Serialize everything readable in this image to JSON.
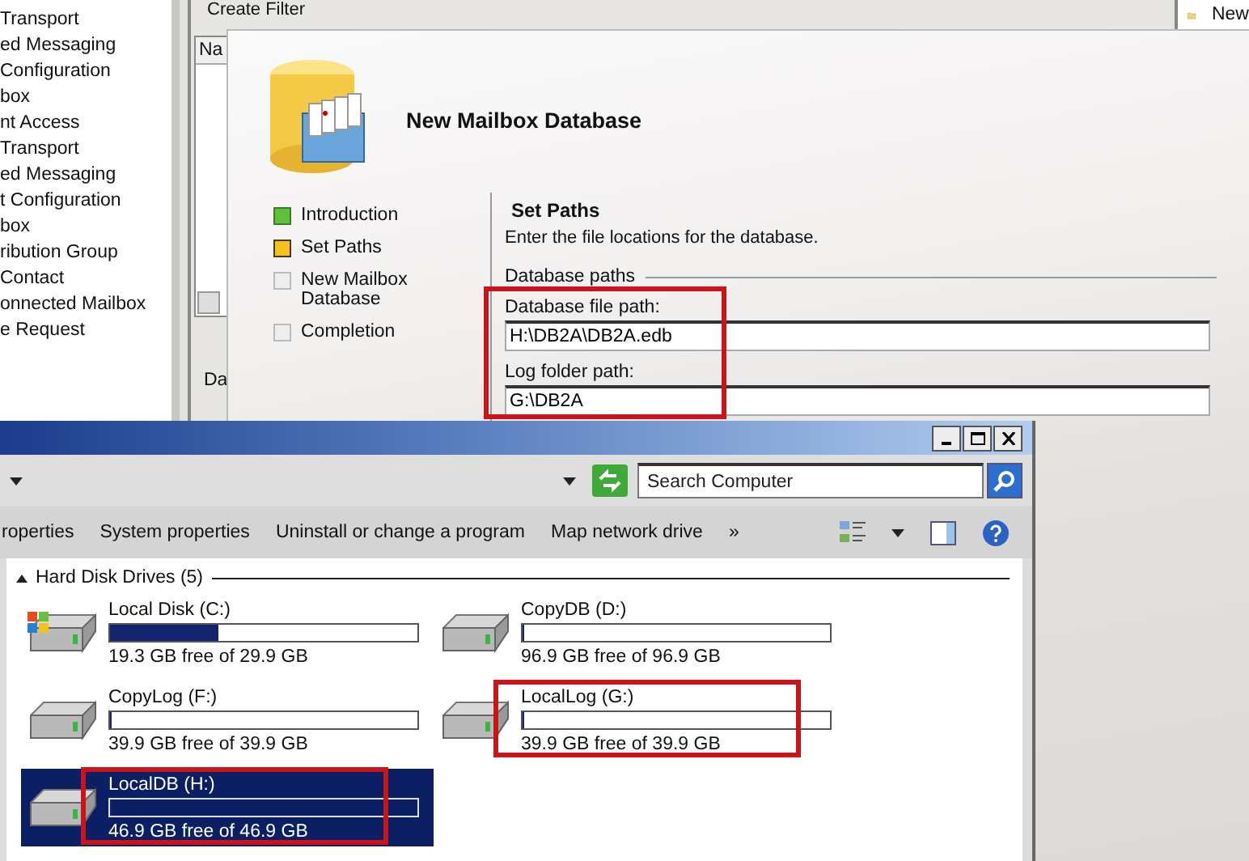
{
  "tree": {
    "items": [
      "Transport",
      "ed Messaging",
      "Configuration",
      "box",
      "nt Access",
      "Transport",
      "ed Messaging",
      "t Configuration",
      "box",
      "ribution Group",
      "Contact",
      "onnected Mailbox",
      "e Request"
    ]
  },
  "mmc": {
    "toolbar_action": "Create Filter",
    "list_header": "Na",
    "details_tab": "Da",
    "right_item": "New"
  },
  "wizard": {
    "title": "New Mailbox Database",
    "steps": [
      {
        "label": "Introduction",
        "completed": true,
        "selected": false
      },
      {
        "label": "Set Paths",
        "completed": false,
        "selected": true
      },
      {
        "label": "New Mailbox Database",
        "completed": false,
        "selected": false
      },
      {
        "label": "Completion",
        "completed": false,
        "selected": false
      }
    ],
    "page": {
      "heading": "Set Paths",
      "description": "Enter the file locations for the database.",
      "group": "Database paths",
      "highlighted": true,
      "fields": [
        {
          "label": "Database file path:",
          "value": "H:\\DB2A\\DB2A.edb"
        },
        {
          "label": "Log folder path:",
          "value": "G:\\DB2A"
        }
      ]
    }
  },
  "explorer": {
    "search": {
      "placeholder": "Search Computer"
    },
    "toolbar": [
      "roperties",
      "System properties",
      "Uninstall or change a program",
      "Map network drive",
      "»"
    ],
    "group": {
      "label": "Hard Disk Drives (5)",
      "expanded": true,
      "drives": [
        {
          "name": "Local Disk (C:)",
          "kind": "system",
          "level": 0.35,
          "free": "19.3 GB free of 29.9 GB",
          "selected": false,
          "highlighted": false
        },
        {
          "name": "CopyDB (D:)",
          "kind": "disk",
          "level": 0,
          "free": "96.9 GB free of 96.9 GB",
          "selected": false,
          "highlighted": false
        },
        {
          "name": "CopyLog (F:)",
          "kind": "disk",
          "level": 0,
          "free": "39.9 GB free of 39.9 GB",
          "selected": false,
          "highlighted": false
        },
        {
          "name": "LocalLog (G:)",
          "kind": "disk",
          "level": 0,
          "free": "39.9 GB free of 39.9 GB",
          "selected": false,
          "highlighted": true
        },
        {
          "name": "LocalDB (H:)",
          "kind": "disk",
          "level": 0,
          "free": "46.9 GB free of 46.9 GB",
          "selected": true,
          "highlighted": true
        }
      ]
    }
  }
}
